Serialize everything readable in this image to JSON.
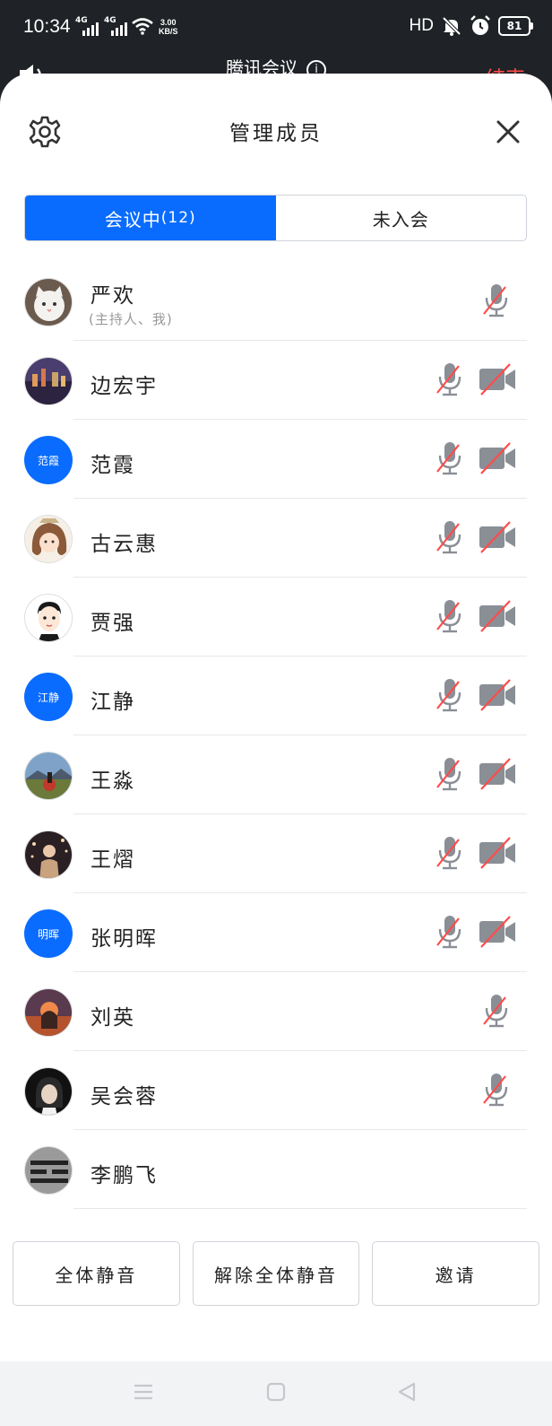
{
  "status_bar": {
    "time": "10:34",
    "network_1": "4G",
    "network_2": "4G",
    "speed_value": "3.00",
    "speed_unit": "KB/S",
    "hd": "HD",
    "battery": "81"
  },
  "meeting": {
    "title": "腾讯会议",
    "end_label": "结束"
  },
  "sheet": {
    "title": "管理成员"
  },
  "tabs": {
    "in_meeting_label": "会议中",
    "in_meeting_count": "(12)",
    "not_joined_label": "未入会"
  },
  "members": [
    {
      "name": "严欢",
      "role": "(主持人、我)",
      "avatar": "cat-photo",
      "mic": "muted",
      "camera": "none"
    },
    {
      "name": "边宏宇",
      "avatar": "city-photo",
      "mic": "muted",
      "camera": "off"
    },
    {
      "name": "范霞",
      "avatar_text": "范霞",
      "avatar_color": "#0a6cff",
      "mic": "muted",
      "camera": "off"
    },
    {
      "name": "古云惠",
      "avatar": "cartoon-girl",
      "mic": "muted",
      "camera": "off"
    },
    {
      "name": "贾强",
      "avatar": "cartoon-boy",
      "mic": "muted",
      "camera": "off"
    },
    {
      "name": "江静",
      "avatar_text": "江静",
      "avatar_color": "#0a6cff",
      "mic": "muted",
      "camera": "off"
    },
    {
      "name": "王淼",
      "avatar": "landscape-photo",
      "mic": "muted",
      "camera": "off"
    },
    {
      "name": "王熠",
      "avatar": "night-photo",
      "mic": "muted",
      "camera": "off"
    },
    {
      "name": "张明晖",
      "avatar_text": "明晖",
      "avatar_color": "#0a6cff",
      "mic": "muted",
      "camera": "off"
    },
    {
      "name": "刘英",
      "avatar": "sunset-photo",
      "mic": "muted",
      "camera": "none"
    },
    {
      "name": "吴会蓉",
      "avatar": "portrait-photo",
      "mic": "muted",
      "camera": "none"
    },
    {
      "name": "李鹏飞",
      "avatar": "trigram-symbol",
      "mic": "none",
      "camera": "none"
    }
  ],
  "actions": {
    "mute_all": "全体静音",
    "unmute_all": "解除全体静音",
    "invite": "邀请"
  },
  "colors": {
    "accent": "#0a6cff",
    "mute_slash": "#ff4b4b",
    "icon_gray": "#8a8f96"
  }
}
